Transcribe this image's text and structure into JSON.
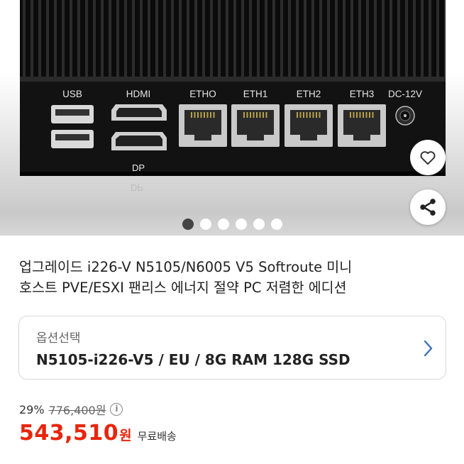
{
  "product_image": {
    "port_labels": [
      "USB",
      "HDMI",
      "ETHO",
      "ETH1",
      "ETH2",
      "ETH3",
      "DC-12V"
    ],
    "dp_label": "DP",
    "colors": {
      "device": "#111111",
      "label": "#e6e6e6"
    }
  },
  "actions": {
    "like_icon": "heart-icon",
    "share_icon": "share-icon"
  },
  "carousel": {
    "count": 6,
    "active_index": 0
  },
  "product": {
    "title_line1": "업그레이드 i226-V N5105/N6005 V5 Softroute 미니",
    "title_line2": "호스트 PVE/ESXI 팬리스 에너지 절약 PC 저렴한 에디션"
  },
  "option": {
    "label": "옵션선택",
    "value": "N5105-i226-V5 / EU / 8G RAM 128G SSD"
  },
  "price": {
    "discount": "29%",
    "original": "776,400원",
    "current": "543,510",
    "currency": "원",
    "shipping": "무료배송",
    "accent_color": "#e8250c"
  }
}
